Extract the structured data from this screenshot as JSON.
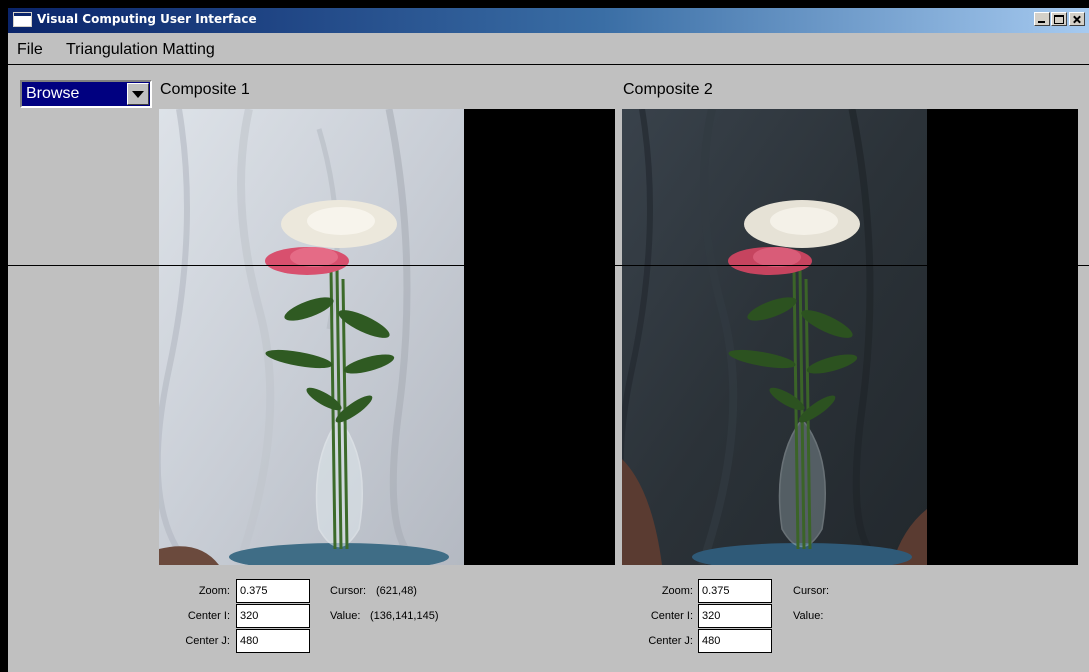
{
  "window": {
    "title": "Visual Computing User Interface"
  },
  "menu": {
    "items": [
      "File",
      "Triangulation Matting"
    ]
  },
  "mode_select": {
    "value": "Browse"
  },
  "panels": [
    {
      "title": "Composite 1",
      "zoom_label": "Zoom:",
      "zoom": "0.375",
      "center_i_label": "Center I:",
      "center_i": "320",
      "center_j_label": "Center J:",
      "center_j": "480",
      "cursor_label": "Cursor:",
      "cursor_value": "(621,48)",
      "value_label": "Value:",
      "value_value": "(136,141,145)"
    },
    {
      "title": "Composite 2",
      "zoom_label": "Zoom:",
      "zoom": "0.375",
      "center_i_label": "Center I:",
      "center_i": "320",
      "center_j_label": "Center J:",
      "center_j": "480",
      "cursor_label": "Cursor:",
      "cursor_value": "",
      "value_label": "Value:",
      "value_value": ""
    }
  ],
  "colors": {
    "title_start": "#0a246a",
    "title_end": "#a6caf0",
    "bg1": "#cfd4dc",
    "bg2": "#2c333b",
    "select": "#000080"
  }
}
